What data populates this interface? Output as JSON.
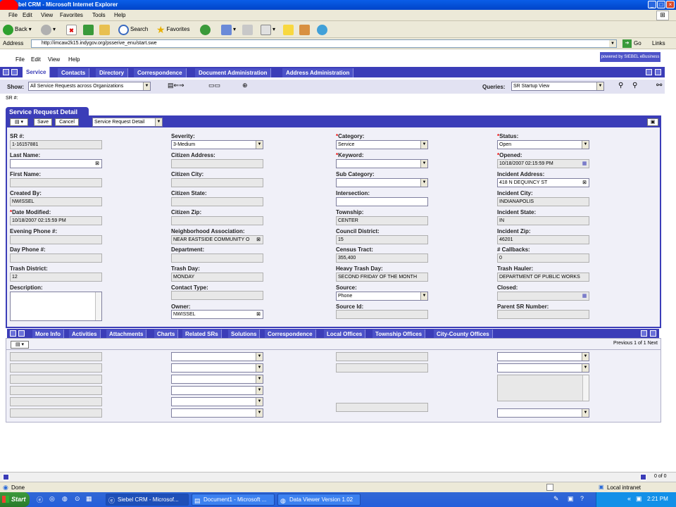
{
  "window": {
    "title": "Siebel CRM - Microsoft Internet Explorer"
  },
  "ie_menu": [
    "File",
    "Edit",
    "View",
    "Favorites",
    "Tools",
    "Help"
  ],
  "ie_toolbar": {
    "back": "Back",
    "search": "Search",
    "favorites": "Favorites"
  },
  "address": {
    "label": "Address",
    "url": "http://imcaw2k15.indygov.org/psserive_enu/start.swe",
    "go": "Go",
    "links": "Links"
  },
  "app_menu": [
    "File",
    "Edit",
    "View",
    "Help"
  ],
  "brand": "powered by SIEBEL eBusiness",
  "tabs": [
    "Service",
    "Contacts",
    "Directory",
    "Correspondence",
    "Document Administration",
    "Address Administration"
  ],
  "show": {
    "label": "Show:",
    "value": "All Service Requests across Organizations"
  },
  "queries": {
    "label": "Queries:",
    "value": "SR Startup View"
  },
  "sr_hash": "SR #:",
  "form": {
    "title": "Service Request Detail",
    "save": "Save",
    "cancel": "Cancel",
    "view": "Service Request Detail",
    "col1": [
      {
        "label": "SR #:",
        "value": "1-16157881"
      },
      {
        "label": "Last Name:",
        "value": ""
      },
      {
        "label": "First Name:",
        "value": ""
      },
      {
        "label": "Created By:",
        "value": "NWISSEL"
      },
      {
        "label": "Date Modified:",
        "value": "10/18/2007 02:15:59 PM",
        "req": "*"
      },
      {
        "label": "Evening Phone #:",
        "value": ""
      },
      {
        "label": "Day Phone #:",
        "value": ""
      },
      {
        "label": "Trash District:",
        "value": "12"
      },
      {
        "label": "Description:",
        "value": ""
      }
    ],
    "col2": [
      {
        "label": "Severity:",
        "value": "3-Medium"
      },
      {
        "label": "Citizen Address:",
        "value": ""
      },
      {
        "label": "Citizen City:",
        "value": ""
      },
      {
        "label": "Citizen State:",
        "value": ""
      },
      {
        "label": "Citizen Zip:",
        "value": ""
      },
      {
        "label": "Neighborhood Association:",
        "value": "NEAR EASTSIDE COMMUNITY O"
      },
      {
        "label": "Department:",
        "value": ""
      },
      {
        "label": "Trash Day:",
        "value": "MONDAY"
      },
      {
        "label": "Contact Type:",
        "value": ""
      },
      {
        "label": "Owner:",
        "value": "NWISSEL"
      }
    ],
    "col3": [
      {
        "label": "Category:",
        "value": "Service",
        "req": "*"
      },
      {
        "label": "Keyword:",
        "value": "",
        "req": "*"
      },
      {
        "label": "Sub Category:",
        "value": ""
      },
      {
        "label": "Intersection:",
        "value": ""
      },
      {
        "label": "Township:",
        "value": "CENTER"
      },
      {
        "label": "Council District:",
        "value": "15"
      },
      {
        "label": "Census Tract:",
        "value": "355,400"
      },
      {
        "label": "Heavy Trash Day:",
        "value": "SECOND FRIDAY OF THE MONTH"
      },
      {
        "label": "Source:",
        "value": "Phone"
      },
      {
        "label": "Source Id:",
        "value": ""
      }
    ],
    "col4": [
      {
        "label": "Status:",
        "value": "Open",
        "req": "*"
      },
      {
        "label": "Opened:",
        "value": "10/18/2007 02:15:59 PM",
        "req": "*"
      },
      {
        "label": "Incident Address:",
        "value": "418 N DEQUINCY  ST"
      },
      {
        "label": "Incident City:",
        "value": "INDIANAPOLIS"
      },
      {
        "label": "Incident State:",
        "value": "IN"
      },
      {
        "label": "Incident Zip:",
        "value": "46201"
      },
      {
        "label": "# Callbacks:",
        "value": "0"
      },
      {
        "label": "Trash Hauler:",
        "value": "DEPARTMENT OF PUBLIC WORKS"
      },
      {
        "label": "Closed:",
        "value": ""
      },
      {
        "label": "Parent SR Number:",
        "value": ""
      }
    ]
  },
  "subtabs": [
    "More Info",
    "Activities",
    "Attachments",
    "Charts",
    "Related SRs",
    "Solutions",
    "Correspondence",
    "Local Offices",
    "Township Offices",
    "City-County Offices"
  ],
  "list": {
    "pager": "Previous 1 of 1 Next"
  },
  "bottom_pager": "0 of 0",
  "status": {
    "text": "Done",
    "zone": "Local intranet"
  },
  "taskbar": {
    "start": "Start",
    "tasks": [
      "Siebel CRM - Microsof...",
      "Document1 - Microsoft ...",
      "Data Viewer Version 1.02"
    ],
    "clock": "2:21 PM"
  }
}
